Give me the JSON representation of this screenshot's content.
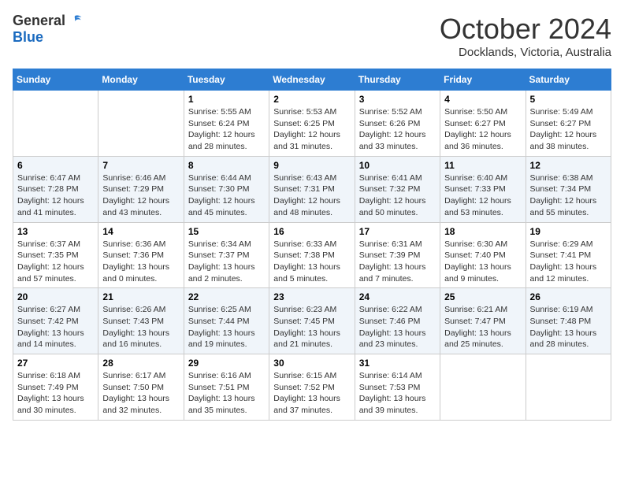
{
  "header": {
    "logo_general": "General",
    "logo_blue": "Blue",
    "month_title": "October 2024",
    "location": "Docklands, Victoria, Australia"
  },
  "days_of_week": [
    "Sunday",
    "Monday",
    "Tuesday",
    "Wednesday",
    "Thursday",
    "Friday",
    "Saturday"
  ],
  "weeks": [
    [
      {
        "day": "",
        "sunrise": "",
        "sunset": "",
        "daylight": ""
      },
      {
        "day": "",
        "sunrise": "",
        "sunset": "",
        "daylight": ""
      },
      {
        "day": "1",
        "sunrise": "Sunrise: 5:55 AM",
        "sunset": "Sunset: 6:24 PM",
        "daylight": "Daylight: 12 hours and 28 minutes."
      },
      {
        "day": "2",
        "sunrise": "Sunrise: 5:53 AM",
        "sunset": "Sunset: 6:25 PM",
        "daylight": "Daylight: 12 hours and 31 minutes."
      },
      {
        "day": "3",
        "sunrise": "Sunrise: 5:52 AM",
        "sunset": "Sunset: 6:26 PM",
        "daylight": "Daylight: 12 hours and 33 minutes."
      },
      {
        "day": "4",
        "sunrise": "Sunrise: 5:50 AM",
        "sunset": "Sunset: 6:27 PM",
        "daylight": "Daylight: 12 hours and 36 minutes."
      },
      {
        "day": "5",
        "sunrise": "Sunrise: 5:49 AM",
        "sunset": "Sunset: 6:27 PM",
        "daylight": "Daylight: 12 hours and 38 minutes."
      }
    ],
    [
      {
        "day": "6",
        "sunrise": "Sunrise: 6:47 AM",
        "sunset": "Sunset: 7:28 PM",
        "daylight": "Daylight: 12 hours and 41 minutes."
      },
      {
        "day": "7",
        "sunrise": "Sunrise: 6:46 AM",
        "sunset": "Sunset: 7:29 PM",
        "daylight": "Daylight: 12 hours and 43 minutes."
      },
      {
        "day": "8",
        "sunrise": "Sunrise: 6:44 AM",
        "sunset": "Sunset: 7:30 PM",
        "daylight": "Daylight: 12 hours and 45 minutes."
      },
      {
        "day": "9",
        "sunrise": "Sunrise: 6:43 AM",
        "sunset": "Sunset: 7:31 PM",
        "daylight": "Daylight: 12 hours and 48 minutes."
      },
      {
        "day": "10",
        "sunrise": "Sunrise: 6:41 AM",
        "sunset": "Sunset: 7:32 PM",
        "daylight": "Daylight: 12 hours and 50 minutes."
      },
      {
        "day": "11",
        "sunrise": "Sunrise: 6:40 AM",
        "sunset": "Sunset: 7:33 PM",
        "daylight": "Daylight: 12 hours and 53 minutes."
      },
      {
        "day": "12",
        "sunrise": "Sunrise: 6:38 AM",
        "sunset": "Sunset: 7:34 PM",
        "daylight": "Daylight: 12 hours and 55 minutes."
      }
    ],
    [
      {
        "day": "13",
        "sunrise": "Sunrise: 6:37 AM",
        "sunset": "Sunset: 7:35 PM",
        "daylight": "Daylight: 12 hours and 57 minutes."
      },
      {
        "day": "14",
        "sunrise": "Sunrise: 6:36 AM",
        "sunset": "Sunset: 7:36 PM",
        "daylight": "Daylight: 13 hours and 0 minutes."
      },
      {
        "day": "15",
        "sunrise": "Sunrise: 6:34 AM",
        "sunset": "Sunset: 7:37 PM",
        "daylight": "Daylight: 13 hours and 2 minutes."
      },
      {
        "day": "16",
        "sunrise": "Sunrise: 6:33 AM",
        "sunset": "Sunset: 7:38 PM",
        "daylight": "Daylight: 13 hours and 5 minutes."
      },
      {
        "day": "17",
        "sunrise": "Sunrise: 6:31 AM",
        "sunset": "Sunset: 7:39 PM",
        "daylight": "Daylight: 13 hours and 7 minutes."
      },
      {
        "day": "18",
        "sunrise": "Sunrise: 6:30 AM",
        "sunset": "Sunset: 7:40 PM",
        "daylight": "Daylight: 13 hours and 9 minutes."
      },
      {
        "day": "19",
        "sunrise": "Sunrise: 6:29 AM",
        "sunset": "Sunset: 7:41 PM",
        "daylight": "Daylight: 13 hours and 12 minutes."
      }
    ],
    [
      {
        "day": "20",
        "sunrise": "Sunrise: 6:27 AM",
        "sunset": "Sunset: 7:42 PM",
        "daylight": "Daylight: 13 hours and 14 minutes."
      },
      {
        "day": "21",
        "sunrise": "Sunrise: 6:26 AM",
        "sunset": "Sunset: 7:43 PM",
        "daylight": "Daylight: 13 hours and 16 minutes."
      },
      {
        "day": "22",
        "sunrise": "Sunrise: 6:25 AM",
        "sunset": "Sunset: 7:44 PM",
        "daylight": "Daylight: 13 hours and 19 minutes."
      },
      {
        "day": "23",
        "sunrise": "Sunrise: 6:23 AM",
        "sunset": "Sunset: 7:45 PM",
        "daylight": "Daylight: 13 hours and 21 minutes."
      },
      {
        "day": "24",
        "sunrise": "Sunrise: 6:22 AM",
        "sunset": "Sunset: 7:46 PM",
        "daylight": "Daylight: 13 hours and 23 minutes."
      },
      {
        "day": "25",
        "sunrise": "Sunrise: 6:21 AM",
        "sunset": "Sunset: 7:47 PM",
        "daylight": "Daylight: 13 hours and 25 minutes."
      },
      {
        "day": "26",
        "sunrise": "Sunrise: 6:19 AM",
        "sunset": "Sunset: 7:48 PM",
        "daylight": "Daylight: 13 hours and 28 minutes."
      }
    ],
    [
      {
        "day": "27",
        "sunrise": "Sunrise: 6:18 AM",
        "sunset": "Sunset: 7:49 PM",
        "daylight": "Daylight: 13 hours and 30 minutes."
      },
      {
        "day": "28",
        "sunrise": "Sunrise: 6:17 AM",
        "sunset": "Sunset: 7:50 PM",
        "daylight": "Daylight: 13 hours and 32 minutes."
      },
      {
        "day": "29",
        "sunrise": "Sunrise: 6:16 AM",
        "sunset": "Sunset: 7:51 PM",
        "daylight": "Daylight: 13 hours and 35 minutes."
      },
      {
        "day": "30",
        "sunrise": "Sunrise: 6:15 AM",
        "sunset": "Sunset: 7:52 PM",
        "daylight": "Daylight: 13 hours and 37 minutes."
      },
      {
        "day": "31",
        "sunrise": "Sunrise: 6:14 AM",
        "sunset": "Sunset: 7:53 PM",
        "daylight": "Daylight: 13 hours and 39 minutes."
      },
      {
        "day": "",
        "sunrise": "",
        "sunset": "",
        "daylight": ""
      },
      {
        "day": "",
        "sunrise": "",
        "sunset": "",
        "daylight": ""
      }
    ]
  ]
}
